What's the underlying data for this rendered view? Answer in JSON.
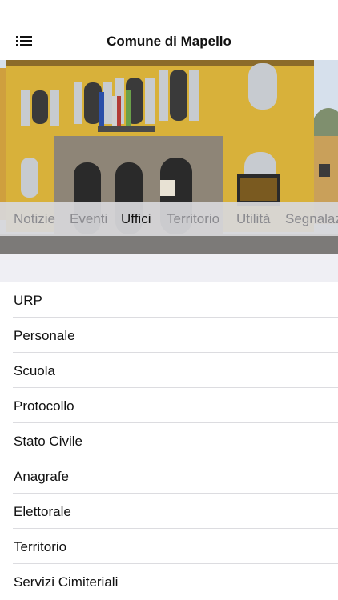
{
  "header": {
    "title": "Comune di Mapello",
    "menu_icon": "list-menu-icon"
  },
  "hero": {
    "image": "town-hall-building-photo"
  },
  "tabs": [
    {
      "label": "Notizie",
      "active": false
    },
    {
      "label": "Eventi",
      "active": false
    },
    {
      "label": "Uffici",
      "active": true
    },
    {
      "label": "Territorio",
      "active": false
    },
    {
      "label": "Utilità",
      "active": false
    },
    {
      "label": "Segnalaz",
      "active": false
    }
  ],
  "offices": [
    {
      "label": "URP"
    },
    {
      "label": "Personale"
    },
    {
      "label": "Scuola"
    },
    {
      "label": "Protocollo"
    },
    {
      "label": "Stato Civile"
    },
    {
      "label": "Anagrafe"
    },
    {
      "label": "Elettorale"
    },
    {
      "label": "Territorio"
    },
    {
      "label": "Servizi Cimiteriali"
    }
  ],
  "colors": {
    "accent_text": "#111111",
    "inactive_tab": "#8a8a8f",
    "building": "#d8b13a"
  }
}
